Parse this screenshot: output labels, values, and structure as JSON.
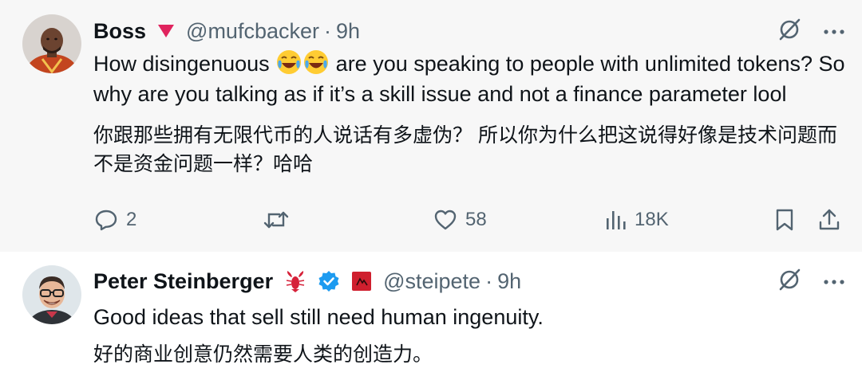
{
  "tweets": [
    {
      "author_name": "Boss",
      "handle": "@mufcbacker",
      "separator": "·",
      "time": "9h",
      "text_en_part1": "How disingenuous",
      "text_en_part2": "are you speaking to people with unlimited tokens? So why are you talking as if it’s a skill issue and not a finance parameter lool",
      "text_zh": "你跟那些拥有无限代币的人说话有多虚伪？ 所以你为什么把这说得好像是技术问题而不是资金问题一样？哈哈",
      "emoji": [
        "face-with-tears-of-joy",
        "face-with-tears-of-joy"
      ],
      "metrics": {
        "replies": "2",
        "reposts": "",
        "likes": "58",
        "views": "18K"
      }
    },
    {
      "author_name": "Peter Steinberger",
      "handle": "@steipete",
      "separator": "·",
      "time": "9h",
      "text_en": "Good ideas that sell still need human ingenuity.",
      "text_zh": "好的商业创意仍然需要人类的创造力。"
    }
  ],
  "icons": {
    "grok": "grok-icon",
    "more": "more-icon",
    "reply": "reply-icon",
    "repost": "repost-icon",
    "like": "like-icon",
    "views": "views-icon",
    "bookmark": "bookmark-icon",
    "share": "share-icon",
    "verified": "verified-badge-icon",
    "lobster": "lobster-emoji-icon",
    "flag": "red-square-flag-icon"
  },
  "colors": {
    "text_primary": "#0f1419",
    "text_secondary": "#536471",
    "verified_blue": "#1d9bf0",
    "accent_red": "#e0245e",
    "thread_line": "#cfd9de",
    "tweet1_bg": "#f7f7f7",
    "tweet2_bg": "#ffffff"
  }
}
